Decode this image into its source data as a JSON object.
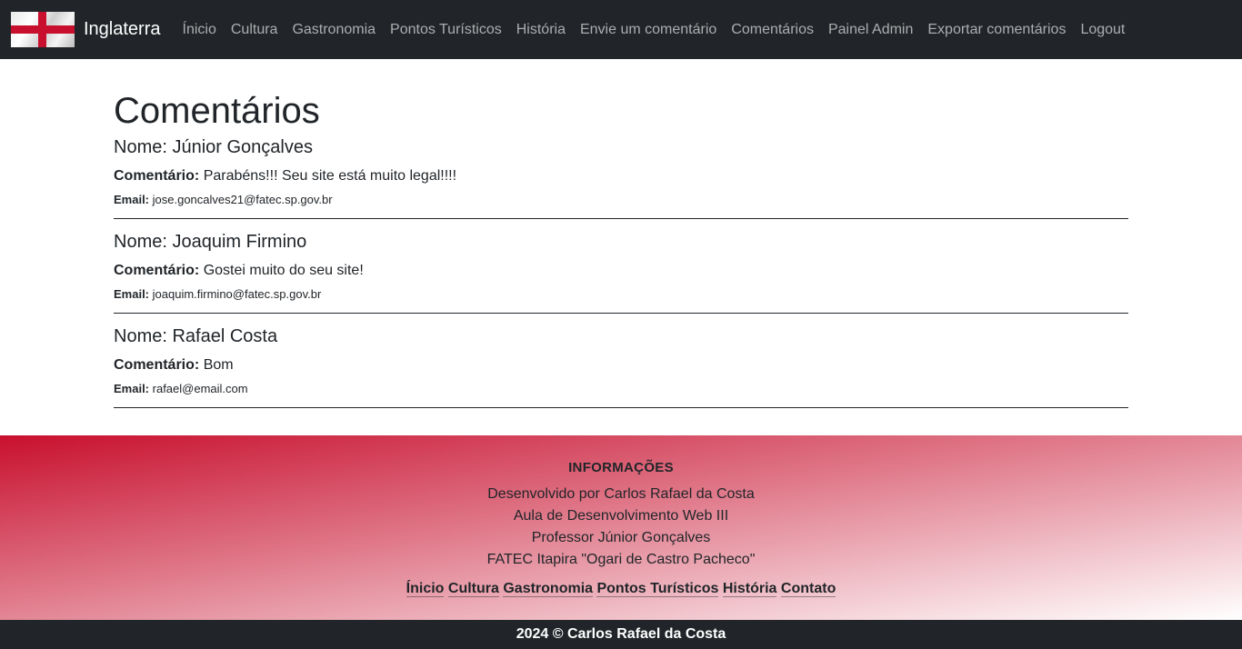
{
  "navbar": {
    "brand": "Inglaterra",
    "links": [
      "Ínicio",
      "Cultura",
      "Gastronomia",
      "Pontos Turísticos",
      "História",
      "Envie um comentário",
      "Comentários",
      "Painel Admin",
      "Exportar comentários",
      "Logout"
    ]
  },
  "main": {
    "title": "Comentários",
    "labels": {
      "comment": "Comentário:",
      "email": "Email:"
    },
    "comments": [
      {
        "name": "Nome: Júnior Gonçalves",
        "text": "Parabéns!!! Seu site está muito legal!!!!",
        "email": "jose.goncalves21@fatec.sp.gov.br"
      },
      {
        "name": "Nome: Joaquim Firmino",
        "text": "Gostei muito do seu site!",
        "email": "joaquim.firmino@fatec.sp.gov.br"
      },
      {
        "name": "Nome: Rafael Costa",
        "text": "Bom",
        "email": "rafael@email.com"
      }
    ]
  },
  "footer": {
    "title": "INFORMAÇÕES",
    "lines": [
      "Desenvolvido por Carlos Rafael da Costa",
      "Aula de Desenvolvimento Web III",
      "Professor Júnior Gonçalves",
      "FATEC Itapira \"Ogari de Castro Pacheco\""
    ],
    "links": [
      "Ínicio",
      "Cultura",
      "Gastronomia",
      "Pontos Turísticos",
      "História",
      "Contato"
    ],
    "copyright": "2024 © Carlos Rafael da Costa"
  },
  "colors": {
    "nav_bg": "#212529",
    "accent_red": "#c8102e",
    "text": "#212529"
  }
}
